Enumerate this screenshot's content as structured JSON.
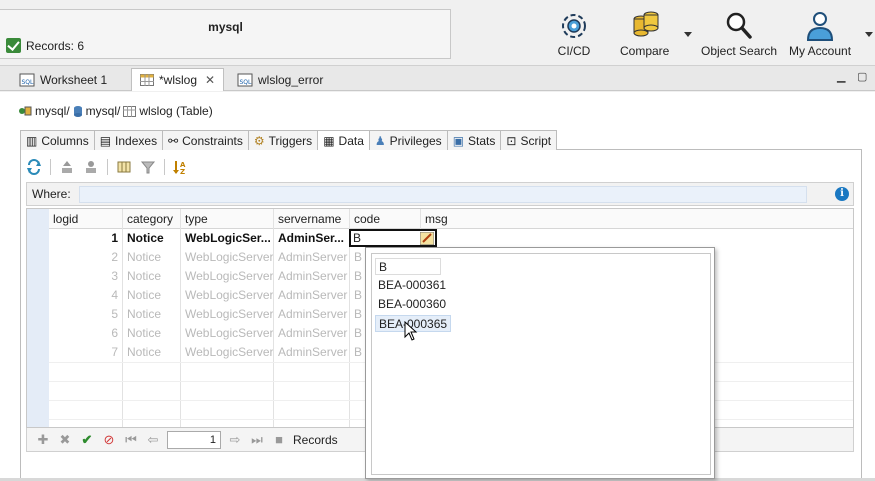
{
  "connection": {
    "title": "mysql",
    "status_text": "Records: 6"
  },
  "toolbar": {
    "cicd": "CI/CD",
    "compare": "Compare",
    "object_search": "Object Search",
    "my_account": "My Account"
  },
  "tabs": [
    {
      "label": "Worksheet 1"
    },
    {
      "label": "*wlslog"
    },
    {
      "label": "wlslog_error"
    }
  ],
  "breadcrumb": {
    "part1": "mysql/",
    "part2": "mysql/",
    "part3": "wlslog (Table)"
  },
  "sub_tabs": [
    "Columns",
    "Indexes",
    "Constraints",
    "Triggers",
    "Data",
    "Privileges",
    "Stats",
    "Script"
  ],
  "where_label": "Where:",
  "grid": {
    "columns": [
      "logid",
      "category",
      "type",
      "servername",
      "code",
      "msg"
    ],
    "editing_value": "B",
    "rows": [
      {
        "logid": "1",
        "category": "Notice",
        "type": "WebLogicSer...",
        "servername": "AdminSer..."
      },
      {
        "logid": "2",
        "category": "Notice",
        "type": "WebLogicServer",
        "servername": "AdminServer",
        "code": "B"
      },
      {
        "logid": "3",
        "category": "Notice",
        "type": "WebLogicServer",
        "servername": "AdminServer",
        "code": "B"
      },
      {
        "logid": "4",
        "category": "Notice",
        "type": "WebLogicServer",
        "servername": "AdminServer",
        "code": "B"
      },
      {
        "logid": "5",
        "category": "Notice",
        "type": "WebLogicServer",
        "servername": "AdminServer",
        "code": "B"
      },
      {
        "logid": "6",
        "category": "Notice",
        "type": "WebLogicServer",
        "servername": "AdminServer",
        "code": "B"
      },
      {
        "logid": "7",
        "category": "Notice",
        "type": "WebLogicServer",
        "servername": "AdminServer",
        "code": "B"
      }
    ]
  },
  "navigation": {
    "page": "1",
    "records_label": "Records"
  },
  "autocomplete": {
    "items": [
      "B",
      "BEA-000361",
      "BEA-000360",
      "BEA-000365"
    ]
  },
  "colors": {
    "accent": "#1a78c2",
    "ok": "#2e8b2e",
    "cancel": "#d23a3a"
  }
}
